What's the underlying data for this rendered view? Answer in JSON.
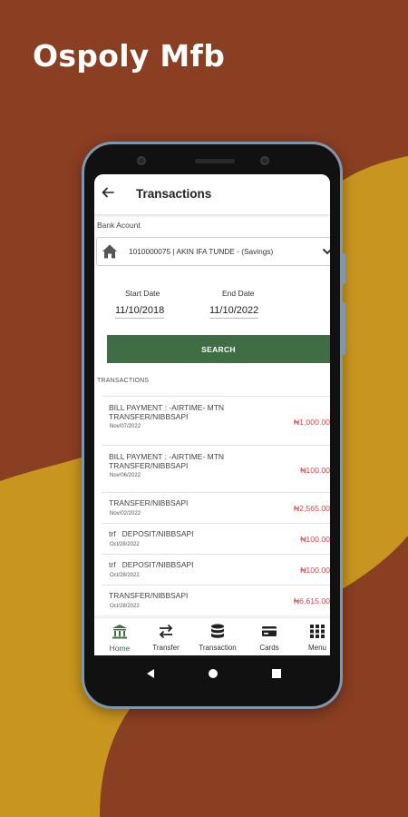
{
  "headline": "Ospoly Mfb",
  "colors": {
    "background_brown": "#8a3e22",
    "background_gold": "#c8951e",
    "primary_green": "#3f6d44",
    "debit_red": "#e14343"
  },
  "app_bar": {
    "title": "Transactions",
    "back_icon": "arrow-left-icon"
  },
  "bank_account": {
    "label": "Bank Acount",
    "selected": "1010000075 | AKIN IFA TUNDE - (Savings)",
    "icon": "house-icon"
  },
  "filters": {
    "start_label": "Start Date",
    "start_value": "11/10/2018",
    "end_label": "End Date",
    "end_value": "11/10/2022",
    "search_label": "SEARCH"
  },
  "transactions_heading": "TRANSACTIONS",
  "transactions": [
    {
      "desc": "BILL PAYMENT : -AIRTIME- MTN\nTRANSFER/NIBBSAPI",
      "date": "Nov/07/2022",
      "amount": "₦1,000.00"
    },
    {
      "desc": "BILL PAYMENT : -AIRTIME- MTN\nTRANSFER/NIBBSAPI",
      "date": "Nov/06/2022",
      "amount": "₦100.00"
    },
    {
      "desc": "TRANSFER/NIBBSAPI",
      "date": "Nov/02/2022",
      "amount": "₦2,565.00"
    },
    {
      "desc": "trf   DEPOSIT/NIBBSAPI",
      "date": "Oct/28/2022",
      "amount": "₦100.00"
    },
    {
      "desc": "trf   DEPOSIT/NIBBSAPI",
      "date": "Oct/28/2022",
      "amount": "₦100.00"
    },
    {
      "desc": "TRANSFER/NIBBSAPI",
      "date": "Oct/28/2022",
      "amount": "₦6,615.00"
    }
  ],
  "nav": [
    {
      "label": "Home",
      "icon": "bank-icon"
    },
    {
      "label": "Transfer",
      "icon": "swap-arrows-icon"
    },
    {
      "label": "Transaction",
      "icon": "database-icon"
    },
    {
      "label": "Cards",
      "icon": "credit-card-icon"
    },
    {
      "label": "Menu",
      "icon": "grid-icon"
    }
  ]
}
